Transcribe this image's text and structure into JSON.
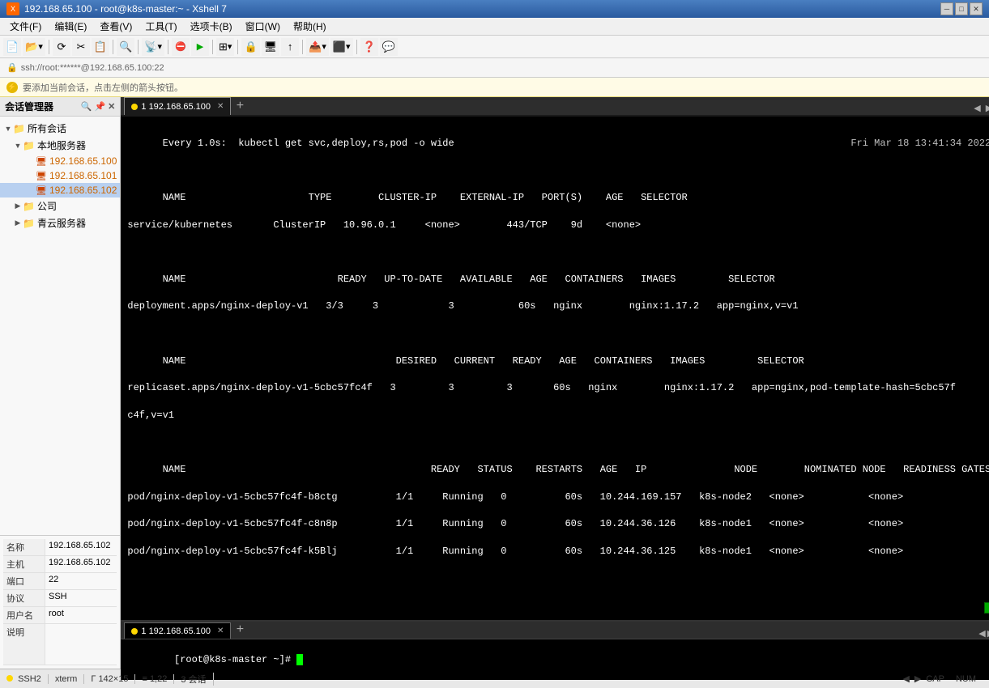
{
  "titlebar": {
    "title": "192.168.65.100 - root@k8s-master:~ - Xshell 7",
    "min_btn": "─",
    "max_btn": "□",
    "close_btn": "✕"
  },
  "menubar": {
    "items": [
      "文件(F)",
      "编辑(E)",
      "查看(V)",
      "工具(T)",
      "选项卡(B)",
      "窗口(W)",
      "帮助(H)"
    ]
  },
  "addressbar": {
    "prefix": "🔒",
    "text": "ssh://root:******@192.168.65.100:22"
  },
  "noticebar": {
    "text": "要添加当前会话，点击左侧的箭头按钮。"
  },
  "sidebar": {
    "title": "会话管理器",
    "pin_icon": "📌",
    "close_icon": "✕",
    "search_placeholder": "搜索",
    "tree": [
      {
        "id": "all",
        "label": "所有会话",
        "level": 0,
        "expanded": true,
        "type": "root"
      },
      {
        "id": "local",
        "label": "本地服务器",
        "level": 1,
        "expanded": true,
        "type": "folder"
      },
      {
        "id": "s100",
        "label": "192.168.65.100",
        "level": 2,
        "type": "server",
        "active": true
      },
      {
        "id": "s101",
        "label": "192.168.65.101",
        "level": 2,
        "type": "server"
      },
      {
        "id": "s102",
        "label": "192.168.65.102",
        "level": 2,
        "type": "server",
        "selected": true
      },
      {
        "id": "company",
        "label": "公司",
        "level": 1,
        "expanded": false,
        "type": "folder"
      },
      {
        "id": "qingyun",
        "label": "青云服务器",
        "level": 1,
        "expanded": false,
        "type": "folder"
      }
    ]
  },
  "info_panel": {
    "rows": [
      {
        "label": "名称",
        "value": "192.168.65.102"
      },
      {
        "label": "主机",
        "value": "192.168.65.102"
      },
      {
        "label": "端口",
        "value": "22"
      },
      {
        "label": "协议",
        "value": "SSH"
      },
      {
        "label": "用户名",
        "value": "root"
      },
      {
        "label": "说明",
        "value": ""
      }
    ]
  },
  "terminal_top": {
    "tab_label": "1 192.168.65.100",
    "header_line": "Every 1.0s:  kubectl get svc,deploy,rs,pod -o wide",
    "timestamp": "Fri Mar 18 13:41:34 2022",
    "content": [
      "NAME                     TYPE        CLUSTER-IP    EXTERNAL-IP   PORT(S)    AGE   SELECTOR",
      "service/kubernetes       ClusterIP   10.96.0.1     <none>        443/TCP    9d    <none>",
      "",
      "NAME                          READY   UP-TO-DATE   AVAILABLE   AGE   CONTAINERS   IMAGES         SELECTOR",
      "deployment.apps/nginx-deploy-v1   3/3     3            3           60s   nginx        nginx:1.17.2   app=nginx,v=v1",
      "",
      "NAME                                    DESIRED   CURRENT   READY   AGE   CONTAINERS   IMAGES         SELECTOR",
      "replicaset.apps/nginx-deploy-v1-5cbc57fc4f   3         3         3       60s   nginx        nginx:1.17.2   app=nginx,pod-template-hash=5cbc57f",
      "c4f,v=v1",
      "",
      "NAME                                          READY   STATUS    RESTARTS   AGE   IP               NODE        NOMINATED NODE   READINESS GATES",
      "pod/nginx-deploy-v1-5cbc57fc4f-b8ctg          1/1     Running   0          60s   10.244.169.157   k8s-node2   <none>           <none>",
      "pod/nginx-deploy-v1-5cbc57fc4f-c8n8p          1/1     Running   0          60s   10.244.36.126    k8s-node1   <none>           <none>",
      "pod/nginx-deploy-v1-5cbc57fc4f-k5Blj          1/1     Running   0          60s   10.244.36.125    k8s-node1   <none>           <none>"
    ]
  },
  "terminal_bottom": {
    "tab_label": "1 192.168.65.100",
    "prompt": "[root@k8s-master ~]# "
  },
  "statusbar": {
    "ssh_label": "SSH2",
    "term_label": "xterm",
    "dimensions": "142×15",
    "position": "1,22",
    "sessions": "3 会话",
    "caps": "CAP",
    "num": "NUM"
  }
}
